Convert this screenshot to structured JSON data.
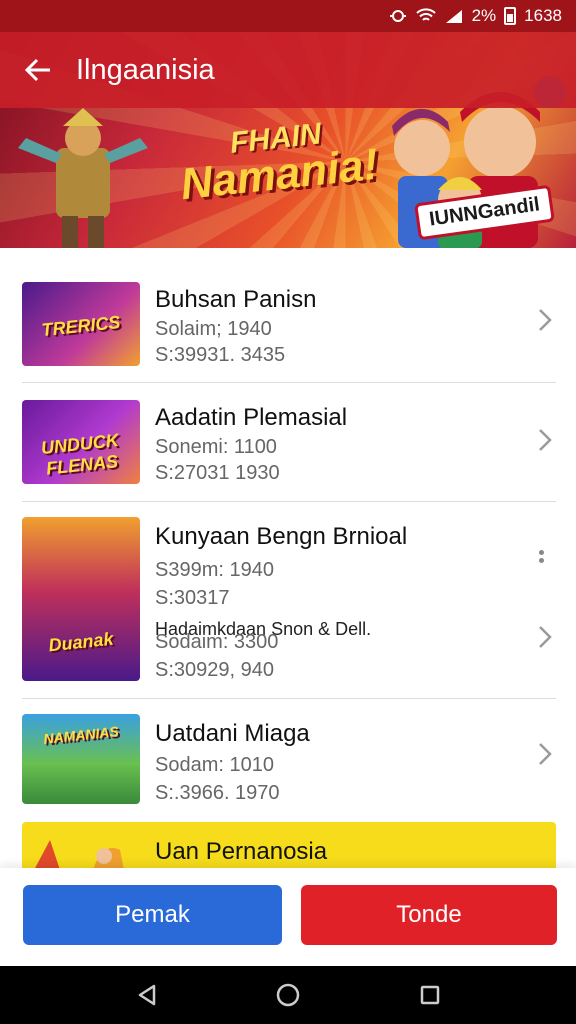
{
  "status_bar": {
    "battery_text": "2%",
    "time": "1638"
  },
  "app_bar": {
    "title": "Ilngaanisia",
    "back_icon": "arrow-left-icon"
  },
  "hero": {
    "logo_line1": "FHAIN",
    "logo_line2": "Namania!",
    "badge": "IUNNGandil"
  },
  "list": [
    {
      "title": "Buhsan Panisn",
      "line1": "Solaim; 1940",
      "line2": "S:39931. 3435",
      "thumb_label": "TRERICS"
    },
    {
      "title": "Aadatin Plemasial",
      "line1": "Sonemi: 1100",
      "line2": "S:27031 1930",
      "thumb_label": "UNDUCK FLENAS"
    },
    {
      "title": "Kunyaan Bengn Brnioal",
      "line1": "S399m: 1940",
      "line2": "S:30317",
      "line3": "Hadaimkdaan Snon & Dell.",
      "line4": "Sodaim: 3300",
      "line5": "S:30929, 940",
      "thumb_label": "Duanak"
    },
    {
      "title": "Uatdani Miaga",
      "line1": "Sodam: 1010",
      "line2": "S:.3966. 1970",
      "thumb_label": "NAMANIAS"
    }
  ],
  "yellow_banner": {
    "title": "Uan Pernanosia"
  },
  "actions": {
    "left_label": "Pemak",
    "right_label": "Tonde"
  },
  "nav": {
    "back": "nav-back-icon",
    "home": "nav-home-icon",
    "recents": "nav-recents-icon"
  },
  "colors": {
    "status": "#9e1418",
    "appbar": "#c81e28",
    "blue": "#2a6ad8",
    "red": "#e02228",
    "yellow": "#f6dc1a"
  }
}
